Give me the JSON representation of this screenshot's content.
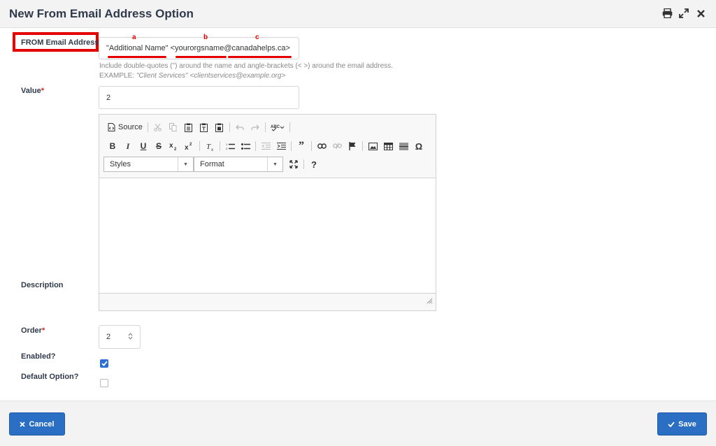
{
  "window": {
    "title": "New From Email Address Option",
    "icons": [
      "print-icon",
      "expand-icon",
      "close-icon"
    ]
  },
  "form": {
    "from_email": {
      "label": "FROM Email Address",
      "value": "\"Additional Name\" <yourorgsname@canadahelps.ca>",
      "annotations": [
        "a",
        "b",
        "c"
      ],
      "help_line1": "Include double-quotes (\") around the name and angle-brackets (< >) around the email address.",
      "help_example_prefix": "EXAMPLE: ",
      "help_example": "\"Client Services\" <clientservices@example.org>"
    },
    "value_field": {
      "label": "Value",
      "value": "2"
    },
    "description": {
      "label": "Description",
      "toolbar": {
        "source_label": "Source",
        "styles_label": "Styles",
        "format_label": "Format",
        "help_label": "?"
      }
    },
    "order": {
      "label": "Order",
      "value": "2"
    },
    "enabled": {
      "label": "Enabled?",
      "checked": true
    },
    "default_option": {
      "label": "Default Option?",
      "checked": false
    },
    "required_marker": "*"
  },
  "footer": {
    "cancel_label": "Cancel",
    "save_label": "Save"
  },
  "colors": {
    "primary": "#2b6fc4",
    "highlight": "#e50000",
    "required": "#d9241b"
  }
}
